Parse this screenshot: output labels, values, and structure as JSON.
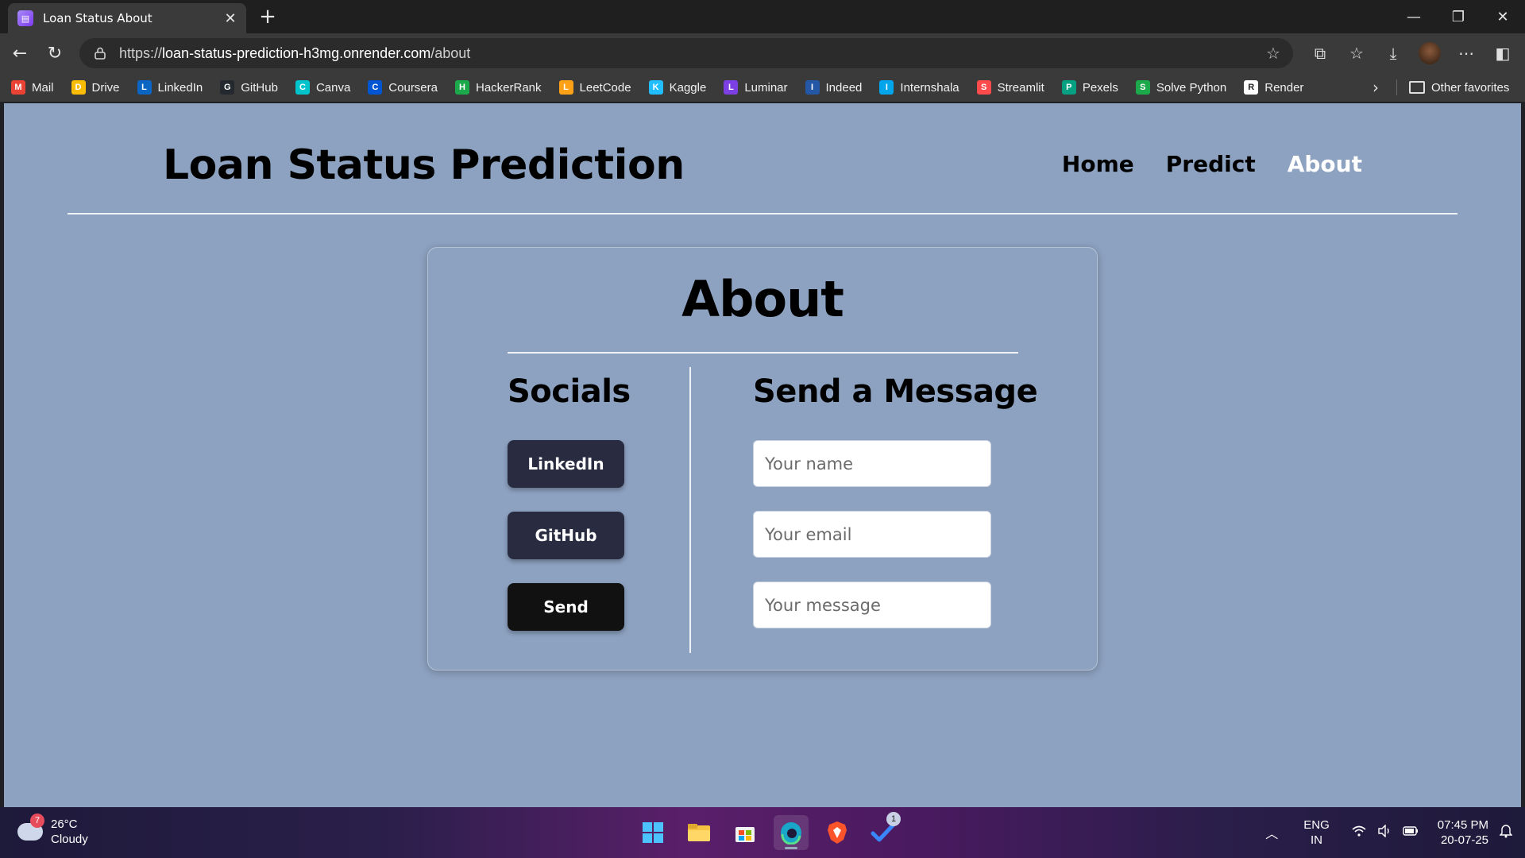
{
  "browser": {
    "tab_title": "Loan Status About",
    "url_prefix": "https://",
    "url_host": "loan-status-prediction-h3mg.onrender.com",
    "url_path": "/about",
    "favorites": [
      {
        "label": "Mail",
        "icon": "gmail-icon",
        "color": "#ea4335"
      },
      {
        "label": "Drive",
        "icon": "drive-icon",
        "color": "#fbbc04"
      },
      {
        "label": "LinkedIn",
        "icon": "linkedin-icon",
        "color": "#0a66c2"
      },
      {
        "label": "GitHub",
        "icon": "github-icon",
        "color": "#24292f"
      },
      {
        "label": "Canva",
        "icon": "canva-icon",
        "color": "#00c4cc"
      },
      {
        "label": "Coursera",
        "icon": "coursera-icon",
        "color": "#0056d2"
      },
      {
        "label": "HackerRank",
        "icon": "hackerrank-icon",
        "color": "#1ba94c"
      },
      {
        "label": "LeetCode",
        "icon": "leetcode-icon",
        "color": "#ffa116"
      },
      {
        "label": "Kaggle",
        "icon": "kaggle-icon",
        "color": "#20beff"
      },
      {
        "label": "Luminar",
        "icon": "luminar-icon",
        "color": "#7b3fe4"
      },
      {
        "label": "Indeed",
        "icon": "indeed-icon",
        "color": "#2557a7"
      },
      {
        "label": "Internshala",
        "icon": "internshala-icon",
        "color": "#00a5ec"
      },
      {
        "label": "Streamlit",
        "icon": "streamlit-icon",
        "color": "#ff4b4b"
      },
      {
        "label": "Pexels",
        "icon": "pexels-icon",
        "color": "#05a081"
      },
      {
        "label": "Solve Python",
        "icon": "solve-python-icon",
        "color": "#1ba94c"
      },
      {
        "label": "Render",
        "icon": "render-icon",
        "color": "#ffffff"
      }
    ],
    "other_favorites": "Other favorites"
  },
  "site": {
    "title": "Loan Status Prediction",
    "nav": {
      "home": "Home",
      "predict": "Predict",
      "about": "About"
    },
    "active_color": "#ffffff",
    "background": "#8da2c1"
  },
  "about": {
    "heading": "About",
    "socials_heading": "Socials",
    "message_heading": "Send a Message",
    "buttons": {
      "linkedin": "LinkedIn",
      "github": "GitHub",
      "send": "Send"
    },
    "fields": {
      "name_placeholder": "Your name",
      "email_placeholder": "Your email",
      "message_placeholder": "Your message"
    }
  },
  "taskbar": {
    "weather_badge": "7",
    "temperature": "26°C",
    "condition": "Cloudy",
    "lang_line1": "ENG",
    "lang_line2": "IN",
    "time": "07:45 PM",
    "date": "20-07-25",
    "todo_badge": "1"
  }
}
